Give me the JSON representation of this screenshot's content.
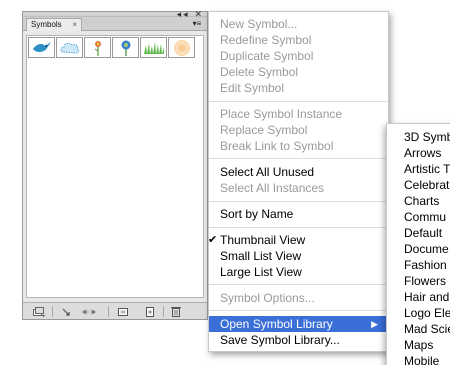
{
  "panel": {
    "tab_label": "Symbols",
    "close_glyph": "×",
    "header_controls": "◂◂ ✕",
    "menu_glyph": "▾≡",
    "thumbnails": [
      {
        "name": "bird-symbol-icon",
        "color": "#2f8fc9"
      },
      {
        "name": "cloud-symbol-icon",
        "color": "#8fc7e8"
      },
      {
        "name": "flower-symbol-icon",
        "color": "#e07a3a"
      },
      {
        "name": "blue-flower-symbol-icon",
        "color": "#3a7fd0"
      },
      {
        "name": "grass-symbol-icon",
        "color": "#5fb84a"
      },
      {
        "name": "sun-symbol-icon",
        "color": "#f5c27a"
      }
    ],
    "footer_icons": [
      "symbol-libraries-menu-icon",
      "place-symbol-icon",
      "break-link-icon",
      "symbol-options-icon",
      "new-symbol-icon",
      "delete-symbol-icon"
    ]
  },
  "menu": {
    "items": [
      {
        "label": "New Symbol...",
        "disabled": true
      },
      {
        "label": "Redefine Symbol",
        "disabled": true
      },
      {
        "label": "Duplicate Symbol",
        "disabled": true
      },
      {
        "label": "Delete Symbol",
        "disabled": true
      },
      {
        "label": "Edit Symbol",
        "disabled": true
      },
      {
        "label": "Place Symbol Instance",
        "disabled": true
      },
      {
        "label": "Replace Symbol",
        "disabled": true
      },
      {
        "label": "Break Link to Symbol",
        "disabled": true
      },
      {
        "label": "Select All Unused",
        "disabled": false
      },
      {
        "label": "Select All Instances",
        "disabled": true
      },
      {
        "label": "Sort by Name",
        "disabled": false
      },
      {
        "label": "Thumbnail View",
        "disabled": false,
        "checked": true
      },
      {
        "label": "Small List View",
        "disabled": false
      },
      {
        "label": "Large List View",
        "disabled": false
      },
      {
        "label": "Symbol Options...",
        "disabled": true
      },
      {
        "label": "Open Symbol Library",
        "disabled": false,
        "highlighted": true,
        "has_submenu": true
      },
      {
        "label": "Save Symbol Library...",
        "disabled": false
      }
    ],
    "check_glyph": "✔",
    "submenu_arrow": "▶"
  },
  "submenu": {
    "items": [
      "3D Symb",
      "Arrows",
      "Artistic T",
      "Celebrat",
      "Charts",
      "Commu",
      "Default",
      "Docume",
      "Fashion",
      "Flowers",
      "Hair and",
      "Logo Ele",
      "Mad Scie",
      "Maps",
      "Mobile"
    ]
  },
  "colors": {
    "highlight": "#3a6fd8",
    "disabled_text": "#9a9a9a",
    "panel_bg": "#e8e8e8"
  }
}
